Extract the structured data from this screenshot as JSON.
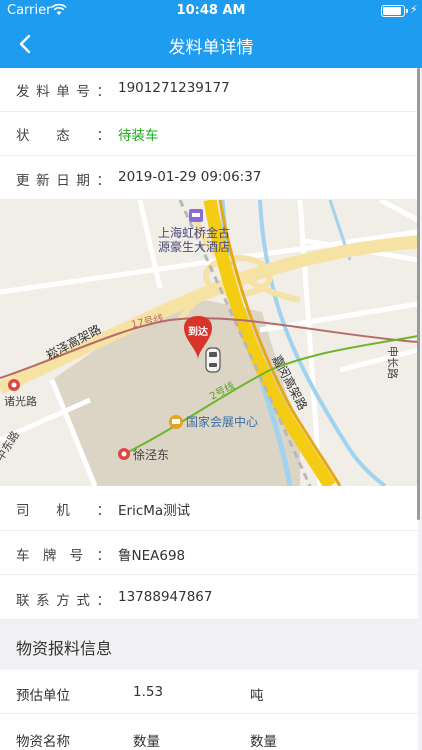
{
  "status_bar": {
    "carrier": "Carrier",
    "time": "10:48 AM",
    "battery_level": 0.9
  },
  "nav": {
    "title": "发料单详情"
  },
  "info": [
    {
      "label": "发料单号：",
      "value": "1901271239177"
    },
    {
      "label": "状态：",
      "value": "待装车"
    },
    {
      "label": "更新日期：",
      "value": "2019-01-29 09:06:37"
    }
  ],
  "map": {
    "roads": {
      "songze": "崧泽高架路",
      "jiamin": "嘉闵高架路",
      "zhuguang": "诸光路",
      "zhongdong": "中东路",
      "shenchang": "申长路"
    },
    "metro": {
      "line17": "17号线",
      "line2": "2号线",
      "xujing_east": "徐泾东"
    },
    "pois": {
      "hotel_line1": "上海虹桥金古",
      "hotel_line2": "源豪生大酒店",
      "expo": "国家会展中心"
    },
    "marker": "到达"
  },
  "driver_info": [
    {
      "label": "司机：",
      "value": "EricMa测试"
    },
    {
      "label": "车牌号：",
      "value": "鲁NEA698"
    },
    {
      "label": "联系方式：",
      "value": "13788947867"
    }
  ],
  "materials": {
    "section_title": "物资报料信息",
    "rows": [
      [
        "预估单位",
        "1.53",
        "吨"
      ],
      [
        "物资名称",
        "数量",
        "数量"
      ]
    ]
  },
  "colors": {
    "header": "#1e9df0",
    "status_green": "#1aad19",
    "marker_red": "#d9342b"
  }
}
